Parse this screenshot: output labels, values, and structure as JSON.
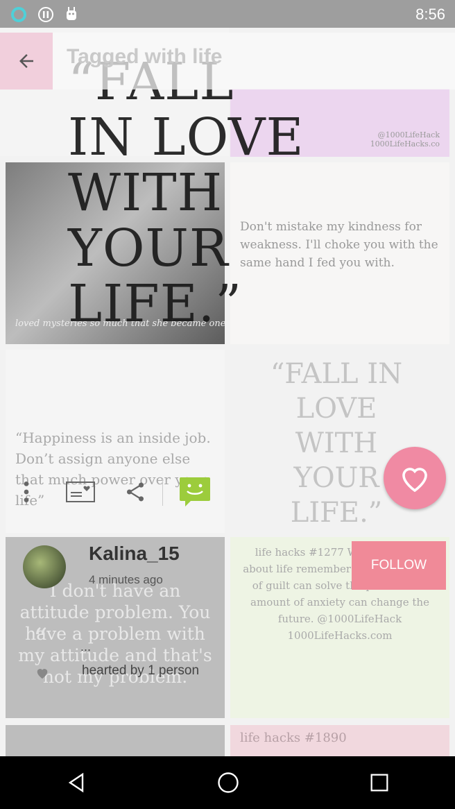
{
  "status_bar": {
    "time": "8:56",
    "icons": [
      "ring-icon",
      "alert-icon",
      "android-icon"
    ]
  },
  "header": {
    "title": "Tagged with life",
    "back_icon": "arrow-back-icon"
  },
  "feature": {
    "quote_lines": [
      "“FALL",
      "IN LOVE",
      "WITH",
      "YOUR",
      "LIFE.”"
    ]
  },
  "tiles": [
    {
      "text": "@1000LifeHack\n1000LifeHacks.co"
    },
    {
      "text": "loved mysteries so much that she became one"
    },
    {
      "text": "Don't mistake my kindness for weakness. I'll choke you with the same hand I fed you with."
    },
    {
      "text": "“Happiness is an inside job. Don’t assign anyone else that much power over your life”"
    },
    {
      "text": "“FALL IN LOVE WITH YOUR LIFE.”"
    },
    {
      "text": "I don't have an attitude problem. You have a problem with my attitude and that's not my problem."
    },
    {
      "text": "life hacks #1277 When thinking about life remember this: no amount of guilt can solve the past and no amount of anxiety can change the future. @1000LifeHack 1000LifeHacks.com"
    },
    {
      "text": "life hacks #1890"
    }
  ],
  "actions": {
    "more_icon": "more-vert-icon",
    "card_icon": "card-icon",
    "share_icon": "share-icon",
    "comment_icon": "comment-icon",
    "heart_icon": "heart-icon"
  },
  "post": {
    "username": "Kalina_15",
    "time_ago": "4 minutes ago",
    "quote_mark": "“",
    "ellipsis": "...",
    "hearted_text": "hearted by 1 person",
    "follow_label": "FOLLOW"
  },
  "colors": {
    "accent_pink": "#f08aa3",
    "comment_green": "#9ccc3c",
    "follow_pink": "#f08a98"
  },
  "nav": [
    "back-icon",
    "home-icon",
    "recents-icon"
  ]
}
